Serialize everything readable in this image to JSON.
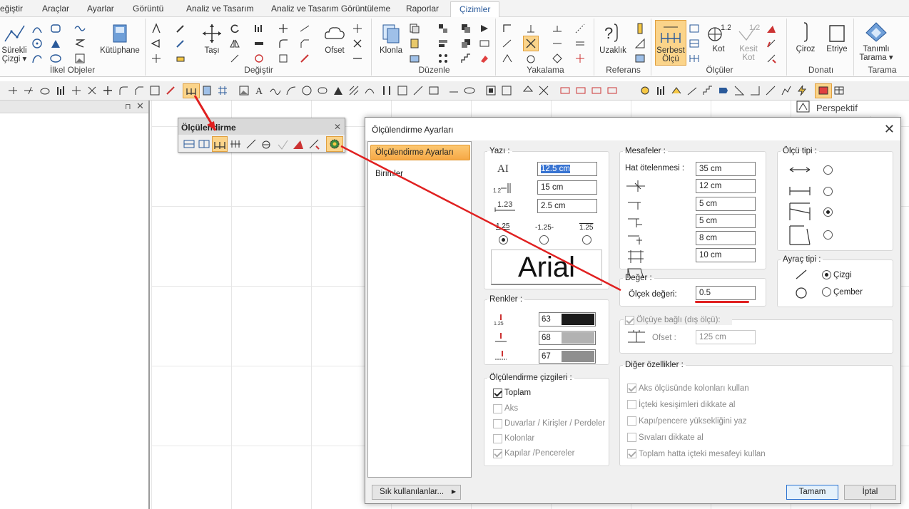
{
  "tabs": [
    "eğiştir",
    "Araçlar",
    "Ayarlar",
    "Görüntü",
    "Analiz ve Tasarım",
    "Analiz ve Tasarım Görüntüleme",
    "Raporlar",
    "Çizimler"
  ],
  "ribbon": {
    "groups": {
      "ilkel": "İlkel Objeler",
      "degistir": "Değiştir",
      "duzenle": "Düzenle",
      "yakalama": "Yakalama",
      "referans": "Referans",
      "olculer": "Ölçüler",
      "donati": "Donatı",
      "tarama": "Tarama"
    },
    "buttons": {
      "surekli": "Sürekli",
      "cizgi": "Çizgi ▾",
      "kutuphane": "Kütüphane",
      "tasi": "Taşı",
      "ofset": "Ofset",
      "klonla": "Klonla",
      "uzaklik": "Uzaklık",
      "serbest": "Serbest",
      "olcu": "Ölçü",
      "kot": "Kot",
      "kesit": "Kesit",
      "kesit_kot": "Kot",
      "ciroz": "Çiroz",
      "etriye": "Etriye",
      "tanimli": "Tanımlı",
      "tarama_btn": "Tarama ▾"
    },
    "kot_value": "1.2",
    "kesit_value": "1.2"
  },
  "perspective_label": "Perspektif",
  "toolbar_window": {
    "title": "Ölçülendirme",
    "close": "✕"
  },
  "dialog": {
    "title": "Ölçülendirme Ayarları",
    "nav": [
      "Ölçülendirme Ayarları",
      "Birimler"
    ],
    "yazi": {
      "legend": "Yazı :",
      "values": [
        "12.5 cm",
        "15 cm",
        "2.5 cm"
      ],
      "icon_text_1": "1.23",
      "pos_labels": [
        "1.25",
        "-1.25-",
        "1.25"
      ],
      "font_preview": "Arial"
    },
    "renkler": {
      "legend": "Renkler :",
      "values": [
        "63",
        "68",
        "67"
      ],
      "swatches": [
        "#1c1c1c",
        "#b2b2b2",
        "#8f8f8f"
      ]
    },
    "olcu_cizgileri": {
      "legend": "Ölçülendirme çizgileri :",
      "items": [
        {
          "label": "Toplam",
          "checked": true,
          "enabled": true
        },
        {
          "label": "Aks",
          "checked": false,
          "enabled": false
        },
        {
          "label": "Duvarlar / Kirişler / Perdeler",
          "checked": false,
          "enabled": false
        },
        {
          "label": "Kolonlar",
          "checked": false,
          "enabled": false
        },
        {
          "label": "Kapılar /Pencereler",
          "checked": true,
          "enabled": false
        }
      ]
    },
    "mesafeler": {
      "legend": "Mesafeler :",
      "hat_label": "Hat ötelenmesi :",
      "values": [
        "35 cm",
        "12 cm",
        "5 cm",
        "5 cm",
        "8 cm",
        "10 cm"
      ]
    },
    "deger": {
      "legend": "Değer :",
      "olcek_label": "Ölçek değeri:",
      "olcek_value": "0.5"
    },
    "olcuye_bagli": {
      "label": "Ölçüye bağlı (dış ölçü):",
      "ofset_label": "Ofset :",
      "ofset_value": "125 cm"
    },
    "olcu_tipi": {
      "legend": "Ölçü tipi :",
      "selected": 2
    },
    "ayrac_tipi": {
      "legend": "Ayraç tipi :",
      "options": [
        "Çizgi",
        "Çember"
      ],
      "selected": 0
    },
    "diger": {
      "legend": "Diğer özellikler :",
      "items": [
        {
          "label": "Aks ölçüsünde kolonları kullan",
          "checked": true
        },
        {
          "label": "İçteki kesişimleri dikkate al",
          "checked": false
        },
        {
          "label": "Kapı/pencere yüksekliğini yaz",
          "checked": false
        },
        {
          "label": "Sıvaları dikkate al",
          "checked": false
        },
        {
          "label": "Toplam hatta içteki mesafeyi kullan",
          "checked": true
        }
      ]
    },
    "footer": {
      "sik": "Sık kullanılanlar...",
      "ok": "Tamam",
      "cancel": "İptal"
    }
  },
  "colors": {
    "accent_orange": "#f6a845",
    "annotation_red": "#e02020",
    "ribbon_bg": "#fbfbfb"
  }
}
